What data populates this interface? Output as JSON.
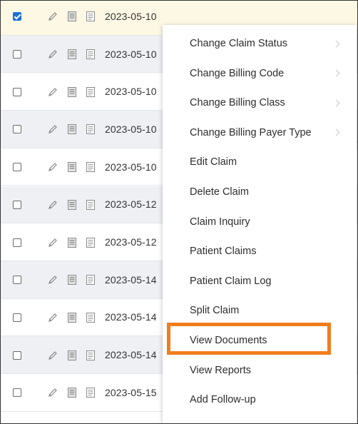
{
  "rows": [
    {
      "date": "2023-05-10",
      "checked": true
    },
    {
      "date": "2023-05-10",
      "checked": false
    },
    {
      "date": "2023-05-10",
      "checked": false
    },
    {
      "date": "2023-05-10",
      "checked": false
    },
    {
      "date": "2023-05-10",
      "checked": false
    },
    {
      "date": "2023-05-12",
      "checked": false
    },
    {
      "date": "2023-05-12",
      "checked": false
    },
    {
      "date": "2023-05-14",
      "checked": false
    },
    {
      "date": "2023-05-14",
      "checked": false
    },
    {
      "date": "2023-05-14",
      "checked": false
    },
    {
      "date": "2023-05-15",
      "checked": false
    }
  ],
  "context_menu": {
    "items": [
      {
        "label": "Change Claim Status",
        "submenu": true
      },
      {
        "label": "Change Billing Code",
        "submenu": true
      },
      {
        "label": "Change Billing Class",
        "submenu": true
      },
      {
        "label": "Change Billing Payer Type",
        "submenu": true
      },
      {
        "label": "Edit Claim",
        "submenu": false
      },
      {
        "label": "Delete Claim",
        "submenu": false
      },
      {
        "label": "Claim Inquiry",
        "submenu": false
      },
      {
        "label": "Patient Claims",
        "submenu": false
      },
      {
        "label": "Patient Claim Log",
        "submenu": false
      },
      {
        "label": "Split Claim",
        "submenu": false
      },
      {
        "label": "View Documents",
        "submenu": false,
        "highlighted": true
      },
      {
        "label": "View Reports",
        "submenu": false
      },
      {
        "label": "Add Follow-up",
        "submenu": false
      }
    ]
  },
  "colors": {
    "highlight_border": "#f07d1e",
    "checkbox_checked": "#1f6fd6"
  }
}
